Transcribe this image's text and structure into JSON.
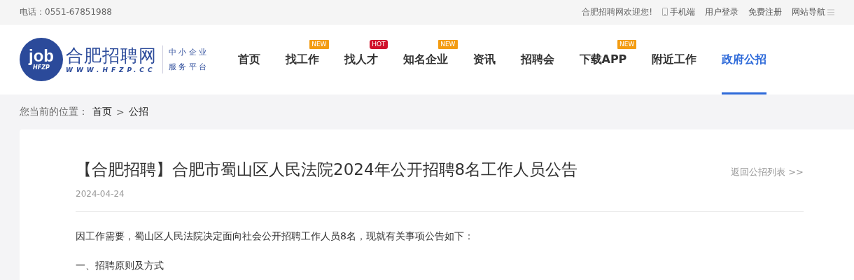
{
  "top_bar": {
    "phone": "电话：0551-67851988",
    "welcome": "合肥招聘网欢迎您!",
    "links": [
      {
        "label": "手机端",
        "kind": "phone"
      },
      {
        "label": "用户登录"
      },
      {
        "label": "免费注册"
      },
      {
        "label": "网站导航",
        "kind": "menu"
      }
    ]
  },
  "logo": {
    "badge_main": "job",
    "badge_sub": "HFZP",
    "name": "合肥招聘网",
    "url": "WWW.HFZP.CC",
    "tagline": [
      "中 小 企 业",
      "服 务 平 台"
    ]
  },
  "nav": [
    {
      "label": "首页",
      "selected": false
    },
    {
      "label": "找工作",
      "selected": false,
      "badge": {
        "kind": "new",
        "text": "NEW"
      }
    },
    {
      "label": "找人才",
      "selected": false,
      "badge": {
        "kind": "hot",
        "text": "HOT"
      }
    },
    {
      "label": "知名企业",
      "selected": false,
      "badge": {
        "kind": "new",
        "text": "NEW"
      }
    },
    {
      "label": "资讯",
      "selected": false
    },
    {
      "label": "招聘会",
      "selected": false
    },
    {
      "label": "下载APP",
      "selected": false,
      "badge": {
        "kind": "new",
        "text": "NEW"
      }
    },
    {
      "label": "附近工作",
      "selected": false
    },
    {
      "label": "政府公招",
      "selected": true
    }
  ],
  "breadcrumb": {
    "prefix": "您当前的位置：",
    "items": [
      "首页",
      "公招"
    ],
    "separator": ">"
  },
  "article": {
    "title": "【合肥招聘】合肥市蜀山区人民法院2024年公开招聘8名工作人员公告",
    "back_link": "返回公招列表 >>",
    "date": "2024-04-24",
    "paragraphs": [
      "因工作需要，蜀山区人民法院决定面向社会公开招聘工作人员8名，现就有关事项公告如下：",
      "一、招聘原则及方式"
    ]
  }
}
